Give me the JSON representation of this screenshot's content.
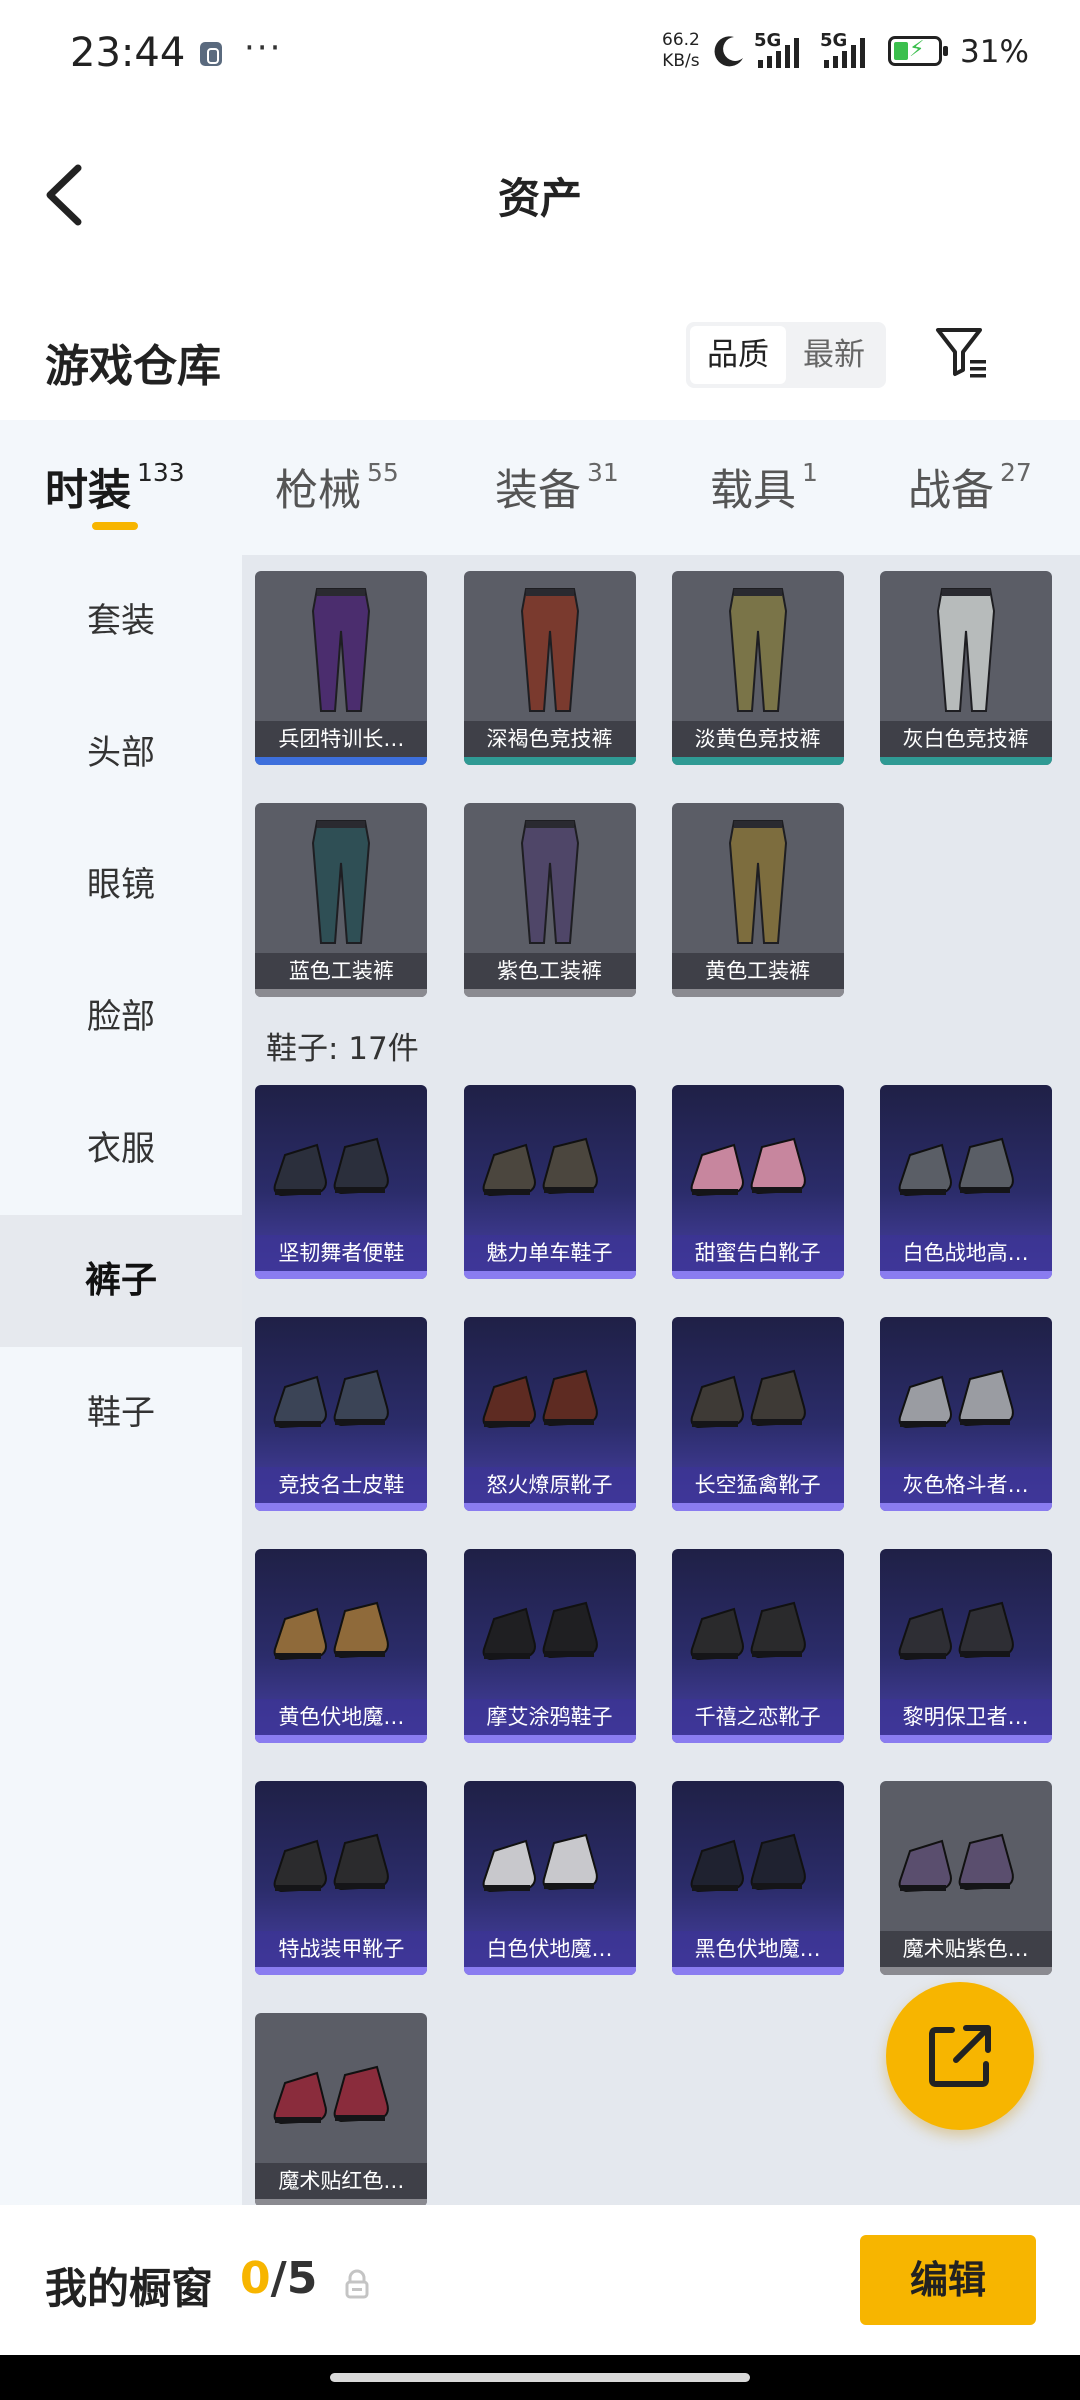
{
  "status_bar": {
    "time": "23:44",
    "more": "···",
    "net_speed_value": "66.2",
    "net_speed_unit": "KB/s",
    "signal1": "5G",
    "signal2": "5G",
    "battery": "31%"
  },
  "header": {
    "title": "资产"
  },
  "warehouse": {
    "title": "游戏仓库",
    "sort": {
      "options": [
        "品质",
        "最新"
      ],
      "selected": "品质"
    }
  },
  "tabs": [
    {
      "label": "时装",
      "count": "133",
      "active": true
    },
    {
      "label": "枪械",
      "count": "55"
    },
    {
      "label": "装备",
      "count": "31"
    },
    {
      "label": "载具",
      "count": "1"
    },
    {
      "label": "战备",
      "count": "27"
    }
  ],
  "sidebar": {
    "items": [
      {
        "label": "套装"
      },
      {
        "label": "头部"
      },
      {
        "label": "眼镜"
      },
      {
        "label": "脸部"
      },
      {
        "label": "衣服"
      },
      {
        "label": "裤子",
        "active": true
      },
      {
        "label": "鞋子"
      }
    ]
  },
  "pants": [
    {
      "name": "兵团特训长…",
      "strip": "#3d6fdc"
    },
    {
      "name": "深褐色竞技裤",
      "strip": "#2f9a94"
    },
    {
      "name": "淡黄色竞技裤",
      "strip": "#2f9a94"
    },
    {
      "name": "灰白色竞技裤",
      "strip": "#2f9a94"
    },
    {
      "name": "蓝色工装裤",
      "strip": "#8a8a90"
    },
    {
      "name": "紫色工装裤",
      "strip": "#8a8a90"
    },
    {
      "name": "黄色工装裤",
      "strip": "#8a8a90"
    }
  ],
  "shoes_section": {
    "title": "鞋子: 17件"
  },
  "shoes": [
    {
      "name": "坚韧舞者便鞋",
      "rarity": "purple"
    },
    {
      "name": "魅力单车鞋子",
      "rarity": "purple"
    },
    {
      "name": "甜蜜告白靴子",
      "rarity": "purple"
    },
    {
      "name": "白色战地高…",
      "rarity": "purple"
    },
    {
      "name": "竞技名士皮鞋",
      "rarity": "purple"
    },
    {
      "name": "怒火燎原靴子",
      "rarity": "purple"
    },
    {
      "name": "长空猛禽靴子",
      "rarity": "purple"
    },
    {
      "name": "灰色格斗者…",
      "rarity": "purple"
    },
    {
      "name": "黄色伏地魔…",
      "rarity": "purple"
    },
    {
      "name": "摩艾涂鸦鞋子",
      "rarity": "purple"
    },
    {
      "name": "千禧之恋靴子",
      "rarity": "purple"
    },
    {
      "name": "黎明保卫者…",
      "rarity": "purple"
    },
    {
      "name": "特战装甲靴子",
      "rarity": "purple"
    },
    {
      "name": "白色伏地魔…",
      "rarity": "purple"
    },
    {
      "name": "黑色伏地魔…",
      "rarity": "purple"
    },
    {
      "name": "魔术贴紫色…",
      "rarity": "grey"
    },
    {
      "name": "魔术贴红色…",
      "rarity": "grey"
    }
  ],
  "bottom": {
    "showcase_label": "我的橱窗",
    "showcase_current": "0",
    "showcase_total": "/5",
    "edit_label": "编辑"
  },
  "colors": {
    "accent": "#f7b500"
  }
}
